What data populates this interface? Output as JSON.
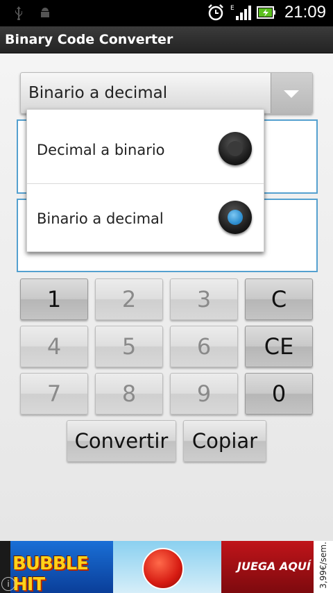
{
  "status_bar": {
    "time": "21:09",
    "icons": [
      "usb-icon",
      "android-debug-icon",
      "alarm-icon",
      "signal-e-icon",
      "battery-charging-icon"
    ]
  },
  "app": {
    "title": "Binary Code Converter"
  },
  "spinner": {
    "selected": "Binario a decimal",
    "icon": "chevron-down-icon"
  },
  "dropdown": {
    "options": [
      {
        "label": "Decimal a binario",
        "selected": false
      },
      {
        "label": "Binario a decimal",
        "selected": true
      }
    ]
  },
  "keypad": {
    "row1": [
      "1",
      "2",
      "3",
      "C"
    ],
    "row2": [
      "4",
      "5",
      "6",
      "CE"
    ],
    "row3": [
      "7",
      "8",
      "9",
      "0"
    ],
    "convert_label": "Convertir",
    "copy_label": "Copiar"
  },
  "ad": {
    "game_title": "BUBBLE HIT",
    "cta": "JUEGA AQUÍ",
    "price": "3,99€/sem.",
    "info_icon": "info-icon"
  },
  "colors": {
    "field_border": "#54a0cf",
    "radio_selected": "#2f8fd0"
  }
}
